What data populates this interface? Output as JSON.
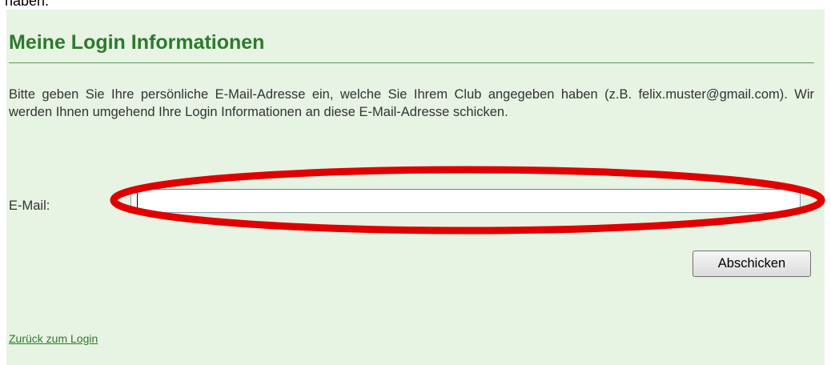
{
  "page": {
    "top_fragment": "haben."
  },
  "form": {
    "title": "Meine Login Informationen",
    "intro": "Bitte geben Sie Ihre persönliche E-Mail-Adresse ein, welche Sie Ihrem Club angegeben haben (z.B. felix.muster@gmail.com). Wir werden Ihnen umgehend Ihre Login Informationen an diese E-Mail-Adresse schicken.",
    "email_label": "E-Mail:",
    "email_value": "",
    "submit_label": "Abschicken",
    "back_link": "Zurück zum Login"
  },
  "colors": {
    "panel_background": "#e7f3e3",
    "title_green": "#2d7a2c",
    "highlight_red": "#e00000"
  }
}
